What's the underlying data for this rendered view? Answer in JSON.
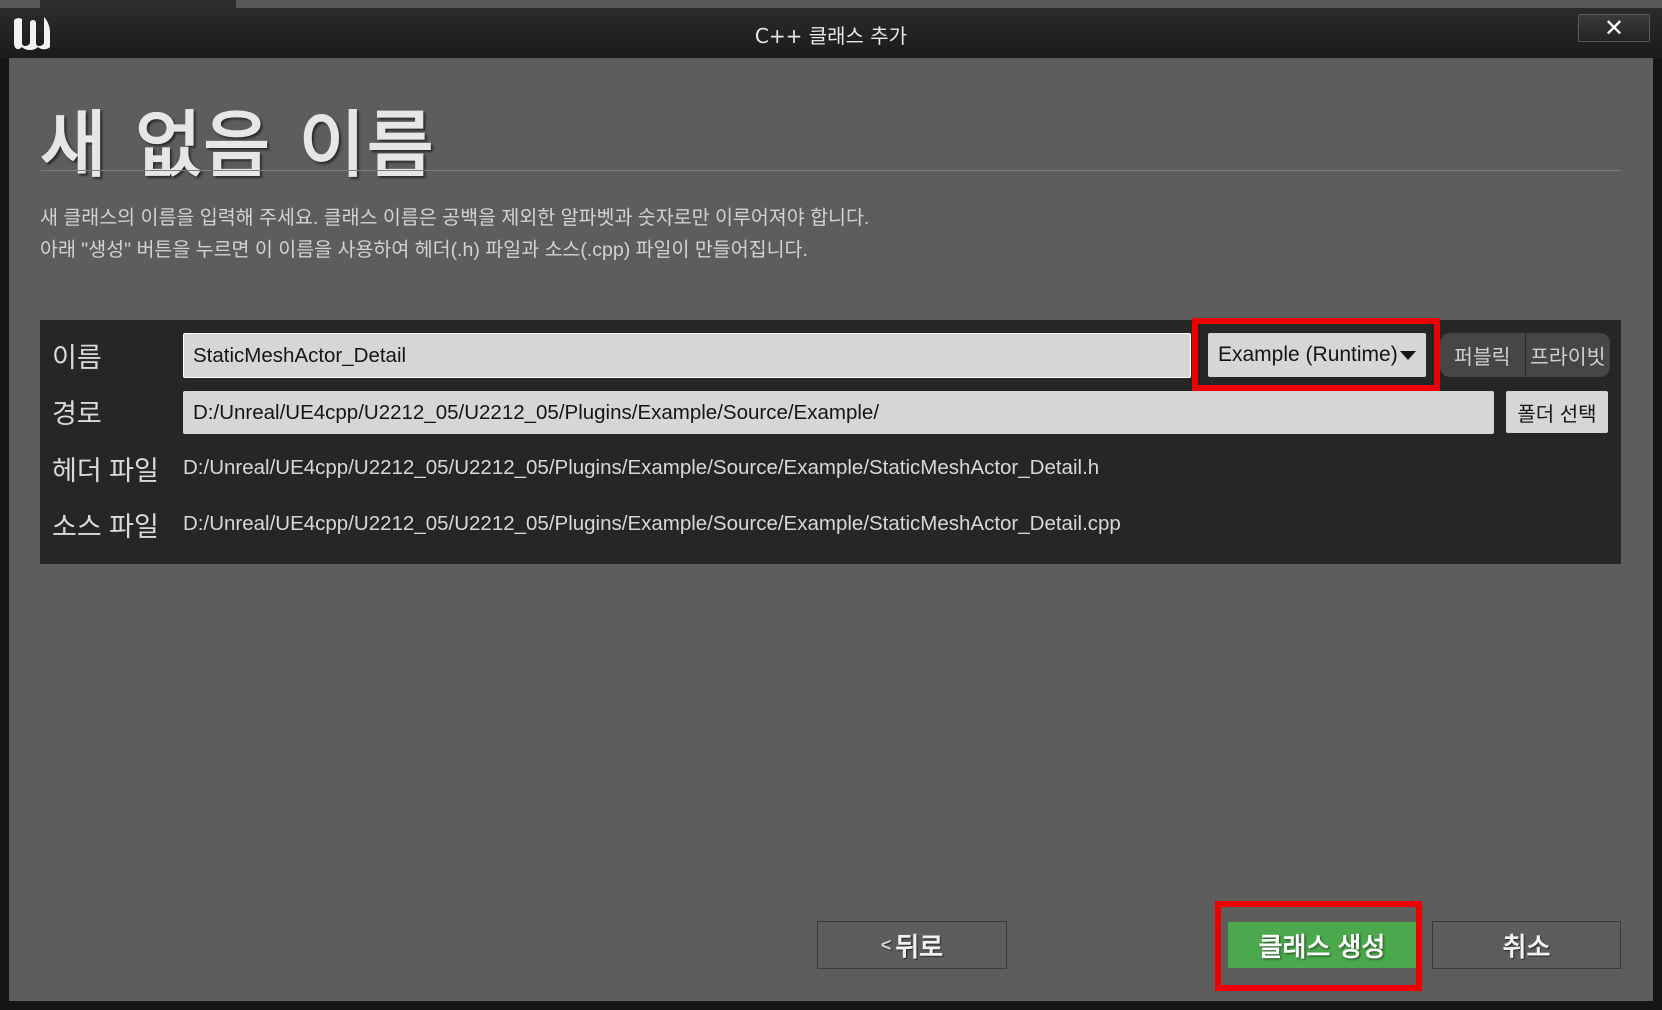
{
  "window": {
    "title": "C++ 클래스 추가",
    "close_symbol": "✕"
  },
  "page": {
    "title": "새 없음 이름",
    "description_line1": "새 클래스의 이름을 입력해 주세요. 클래스 이름은 공백을 제외한 알파벳과 숫자로만 이루어져야 합니다.",
    "description_line2": "아래 \"생성\" 버튼을 누르면 이 이름을 사용하여 헤더(.h) 파일과 소스(.cpp) 파일이 만들어집니다."
  },
  "form": {
    "name_label": "이름",
    "name_value": "StaticMeshActor_Detail",
    "module_value": "Example (Runtime)",
    "public_label": "퍼블릭",
    "private_label": "프라이빗",
    "path_label": "경로",
    "path_value": "D:/Unreal/UE4cpp/U2212_05/U2212_05/Plugins/Example/Source/Example/",
    "folder_button": "폴더 선택",
    "header_label": "헤더 파일",
    "header_value": "D:/Unreal/UE4cpp/U2212_05/U2212_05/Plugins/Example/Source/Example/StaticMeshActor_Detail.h",
    "source_label": "소스 파일",
    "source_value": "D:/Unreal/UE4cpp/U2212_05/U2212_05/Plugins/Example/Source/Example/StaticMeshActor_Detail.cpp"
  },
  "buttons": {
    "back": "뒤로",
    "create": "클래스 생성",
    "cancel": "취소"
  },
  "icons": {
    "app_logo": "unreal-logo-icon",
    "close": "close-icon",
    "dropdown": "caret-down-icon",
    "back": "chevron-left-icon"
  },
  "colors": {
    "highlight": "#ee0000",
    "create_button": "#4ca84c"
  }
}
